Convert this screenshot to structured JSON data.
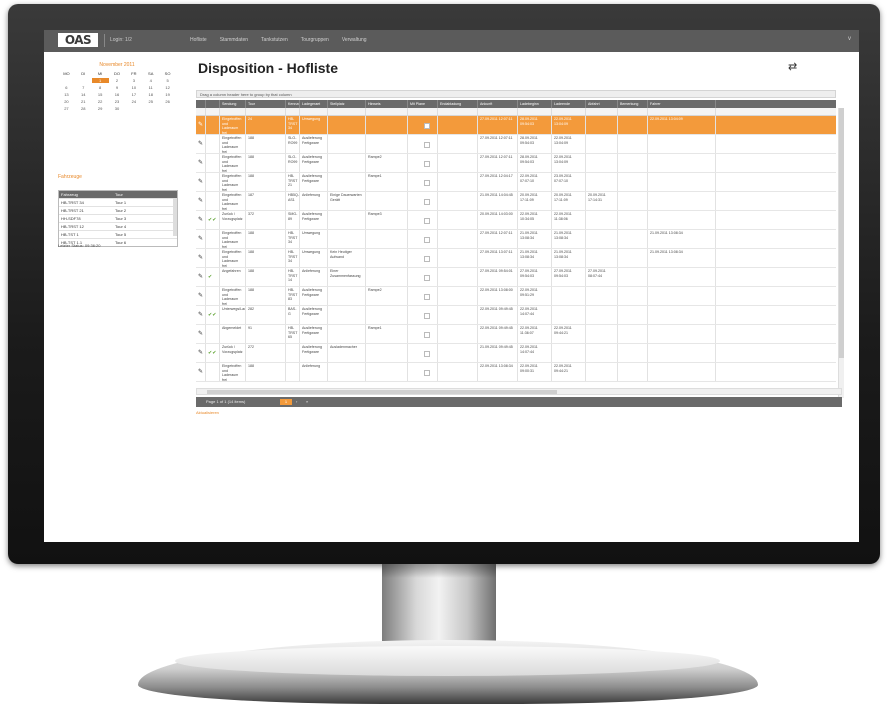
{
  "app": {
    "logo": "OAS",
    "login": "Login: 1/2",
    "nav": [
      "Hofliste",
      "Stammdaten",
      "Tankstutzen",
      "Tourgruppen",
      "Verwaltung"
    ],
    "chevron": "v"
  },
  "calendar": {
    "title": "November 2011",
    "weekdays": [
      "MO",
      "DI",
      "MI",
      "DO",
      "FR",
      "SA",
      "SO"
    ],
    "days": [
      "",
      "",
      "1",
      "2",
      "3",
      "4",
      "5",
      "6",
      "7",
      "8",
      "9",
      "10",
      "11",
      "12",
      "13",
      "14",
      "15",
      "16",
      "17",
      "18",
      "19",
      "20",
      "21",
      "22",
      "23",
      "24",
      "25",
      "26",
      "27",
      "28",
      "29",
      "30",
      "",
      "",
      "",
      ""
    ],
    "selected_day": "1"
  },
  "left": {
    "counter_label": "Fahrzeuge",
    "mini_headers": [
      "Fahrzeug",
      "Tour"
    ],
    "mini_rows": [
      [
        "HB-TRST 34",
        "Tour 1"
      ],
      [
        "HB-TRST 21",
        "Tour 2"
      ],
      [
        "HH-SDF78",
        "Tour 3"
      ],
      [
        "HB-TRST 12",
        "Tour 4"
      ],
      [
        "HB-TST 1",
        "Tour 5"
      ],
      [
        "HB-TST 1.1",
        "Tour 6"
      ]
    ],
    "last_status": "Letzter Status: 09:36:20"
  },
  "main": {
    "title": "Disposition - Hofliste",
    "swap_icon": "⇄",
    "group_hint": "Drag a column header here to group by that column",
    "columns": [
      "",
      "",
      "Sendung",
      "Tour",
      "Kennzeichen",
      "Ladegeraet",
      "Stellplatz",
      "Hinweis",
      "Mit Plane",
      "Endabladung",
      "Ankunft",
      "Ladebeginn",
      "Ladeende",
      "Abfahrt",
      "Bemerkung",
      "Fahrer"
    ],
    "rows": [
      {
        "status": "",
        "sendung": "Eingetroffen und Laderaum frei",
        "tour": "24",
        "kennz": "HB-TRST 34",
        "ladeg": "Umwegung",
        "stell": "",
        "hinweis": "",
        "anz": "27.09.2011 12:07:11",
        "ladeb": "28.09.2011 09:54:03",
        "ladee": "22.09.2011 13:04:09",
        "abf": "",
        "bem": "22.09.2011 13:04:09",
        "selected": true
      },
      {
        "status": "",
        "sendung": "Eingetroffen und Laderaum frei",
        "tour": "188",
        "kennz": "SLO-RO99",
        "ladeg": "Auslieferung Fertigware",
        "stell": "",
        "hinweis": "",
        "anz": "27.09.2011 12:07:11",
        "ladeb": "28.09.2011 09:54:03",
        "ladee": "22.09.2011 13:04:09",
        "abf": "",
        "bem": "",
        "selected": false
      },
      {
        "status": "",
        "sendung": "Eingetroffen und Laderaum frei",
        "tour": "188",
        "kennz": "SLO-RO99",
        "ladeg": "Auslieferung Fertigware",
        "stell": "",
        "hinweis": "Rampe2",
        "anz": "27.09.2011 12:07:11",
        "ladeb": "28.09.2011 09:54:03",
        "ladee": "22.09.2011 13:04:09",
        "abf": "",
        "bem": "",
        "selected": false
      },
      {
        "status": "",
        "sendung": "Eingetroffen und Laderaum frei",
        "tour": "188",
        "kennz": "HB-TRST 21",
        "ladeg": "Auslieferung Fertigware",
        "stell": "",
        "hinweis": "Rampe1",
        "anz": "27.09.2011 12:04:17",
        "ladeb": "22.09.2011 07:07:10",
        "ladee": "23.09.2011 07:07:10",
        "abf": "",
        "bem": "",
        "selected": false
      },
      {
        "status": "",
        "sendung": "Eingetroffen und Laderaum frei",
        "tour": "187",
        "kennz": "HB5Q-AS1",
        "ladeg": "Anlieferung",
        "stell": "Einige Dauerwarten Gerätt",
        "hinweis": "",
        "anz": "21.09.2011 14:04:45",
        "ladeb": "20.09.2011 17:11:09",
        "ladee": "20.09.2011 17:11:09",
        "abf": "20.09.2011 17:14:31",
        "bem": "",
        "selected": false
      },
      {
        "status": "✔✔",
        "sendung": "Zurück / Vorzugsplatz",
        "tour": "372",
        "kennz": "SMG-89",
        "ladeg": "Auslieferung Fertigware",
        "stell": "",
        "hinweis": "Rampe3",
        "anz": "20.09.2011 14:03:00",
        "ladeb": "22.09.2011 10:34:05",
        "ladee": "22.09.2011 11:38:06",
        "abf": "",
        "bem": "",
        "selected": false
      },
      {
        "status": "",
        "sendung": "Eingetroffen und Laderaum frei",
        "tour": "188",
        "kennz": "HB-TRST 34",
        "ladeg": "Umwegung",
        "stell": "",
        "hinweis": "",
        "anz": "27.09.2011 12:07:11",
        "ladeb": "21.09.2011 13:08:34",
        "ladee": "21.09.2011 13:08:34",
        "abf": "",
        "bem": "21.09.2011 13:08:34",
        "selected": false
      },
      {
        "status": "",
        "sendung": "Eingetroffen und Laderaum frei",
        "tour": "188",
        "kennz": "HB-TRST 34",
        "ladeg": "Umwegung",
        "stell": "Kein Heutiger Aufwand",
        "hinweis": "",
        "anz": "27.09.2011 13:07:11",
        "ladeb": "21.09.2011 13:08:34",
        "ladee": "21.09.2011 13:08:34",
        "abf": "",
        "bem": "21.09.2011 13:08:34",
        "selected": false
      },
      {
        "status": "✔",
        "sendung": "Angefahren",
        "tour": "188",
        "kennz": "HB-TRST 14",
        "ladeg": "Anlieferung",
        "stell": "Einer Zusammenfassung",
        "hinweis": "",
        "anz": "27.09.2011 09:54:01",
        "ladeb": "27.09.2011 09:54:03",
        "ladee": "27.09.2011 09:54:03",
        "abf": "27.09.2011 08:07:44",
        "bem": "",
        "selected": false
      },
      {
        "status": "",
        "sendung": "Eingetroffen und Laderaum frei",
        "tour": "188",
        "kennz": "HB-TRST 83",
        "ladeg": "Auslieferung Fertigware",
        "stell": "",
        "hinweis": "Rampe2",
        "anz": "22.09.2011 13:08:00",
        "ladeb": "22.09.2011 09:51:29",
        "ladee": "",
        "abf": "",
        "bem": "",
        "selected": false
      },
      {
        "status": "✔✔",
        "sendung": "Unterwegs/Laden",
        "tour": "282",
        "kennz": "BAS-G",
        "ladeg": "Auslieferung Fertigware",
        "stell": "",
        "hinweis": "",
        "anz": "22.09.2011 09:49:45",
        "ladeb": "22.09.2011 14:07:44",
        "ladee": "",
        "abf": "",
        "bem": "",
        "selected": false
      },
      {
        "status": "",
        "sendung": "Abgemeldet",
        "tour": "91",
        "kennz": "HB-TRST 65",
        "ladeg": "Auslieferung Fertigware",
        "stell": "",
        "hinweis": "Rampe1",
        "anz": "22.09.2011 09:49:45",
        "ladeb": "22.09.2011 11:36:07",
        "ladee": "22.09.2011 09:44:21",
        "abf": "",
        "bem": "",
        "selected": false
      },
      {
        "status": "✔✔",
        "sendung": "Zurück / Vorzugsplatz",
        "tour": "272",
        "kennz": "",
        "ladeg": "Auslieferung Fertigware",
        "stell": "Ausladenmacher",
        "hinweis": "",
        "anz": "21.09.2011 09:49:45",
        "ladeb": "22.09.2011 14:07:44",
        "ladee": "",
        "abf": "",
        "bem": "",
        "selected": false
      },
      {
        "status": "",
        "sendung": "Eingetroffen und Laderaum frei",
        "tour": "188",
        "kennz": "",
        "ladeg": "Anlieferung",
        "stell": "",
        "hinweis": "",
        "anz": "22.09.2011 13:08:34",
        "ladeb": "22.09.2011 09:00:31",
        "ladee": "22.09.2011 09:44:21",
        "abf": "",
        "bem": "",
        "selected": false
      }
    ],
    "pager_info": "Page 1 of 1 (14 items)",
    "page_number": "1",
    "pager_next": "›",
    "pager_last": "»",
    "refresh": "Aktualisieren"
  }
}
